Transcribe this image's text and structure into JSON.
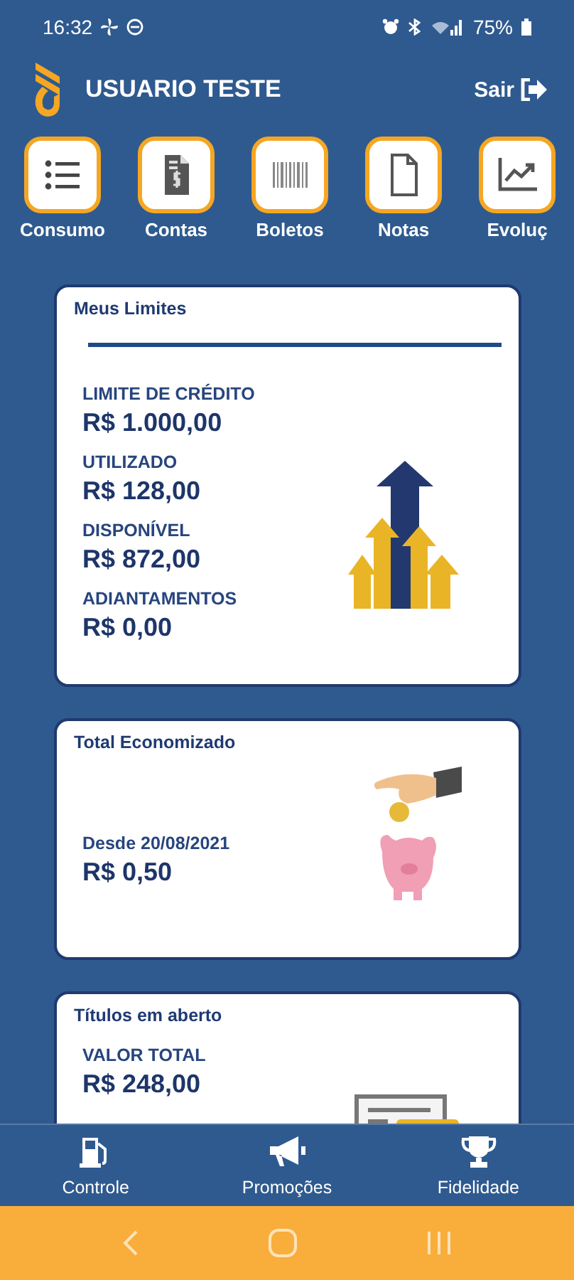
{
  "status_bar": {
    "time": "16:32",
    "battery": "75%"
  },
  "header": {
    "user": "USUARIO TESTE",
    "logout": "Sair"
  },
  "shortcuts": [
    {
      "label": "Consumo"
    },
    {
      "label": "Contas"
    },
    {
      "label": "Boletos"
    },
    {
      "label": "Notas"
    },
    {
      "label": "Evoluç"
    }
  ],
  "cards": [
    {
      "kind": "growth",
      "title": "Meus Limites",
      "divider": true,
      "fields": [
        {
          "label": "LIMITE DE CRÉDITO",
          "value": "R$ 1.000,00"
        },
        {
          "label": "UTILIZADO",
          "value": "R$ 128,00"
        },
        {
          "label": "DISPONÍVEL",
          "value": "R$ 872,00"
        },
        {
          "label": "ADIANTAMENTOS",
          "value": "R$ 0,00"
        }
      ]
    },
    {
      "kind": "savings",
      "title": "Total Economizado",
      "divider": false,
      "fields": [
        {
          "label": "Desde 20/08/2021",
          "value": "R$ 0,50"
        }
      ]
    },
    {
      "kind": "bill",
      "title": "Títulos em aberto",
      "divider": false,
      "fields": [
        {
          "label": "VALOR TOTAL",
          "value": "R$ 248,00"
        }
      ]
    }
  ],
  "bottom_nav": [
    {
      "label": "Controle"
    },
    {
      "label": "Promoções"
    },
    {
      "label": "Fidelidade"
    }
  ]
}
